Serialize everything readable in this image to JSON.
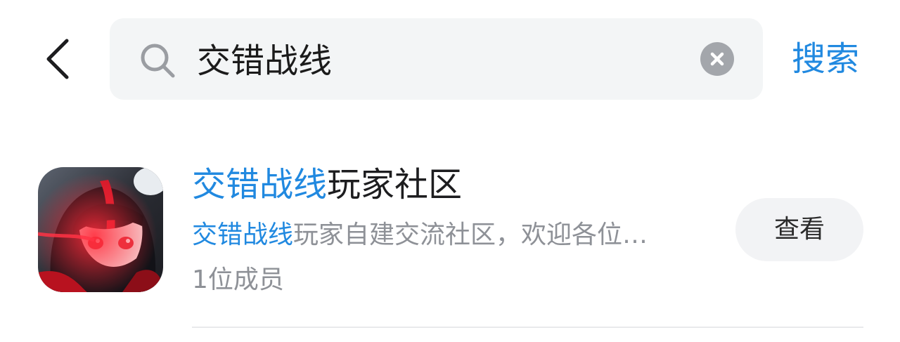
{
  "header": {
    "search_query": "交错战线",
    "search_button_label": "搜索",
    "accent_color": "#2189e0"
  },
  "results": [
    {
      "title_highlight": "交错战线",
      "title_rest": "玩家社区",
      "desc_highlight": "交错战线",
      "desc_rest": "玩家自建交流社区，欢迎各位…",
      "members": "1位成员",
      "view_label": "查看"
    }
  ],
  "icons": {
    "back": "chevron-left-icon",
    "search": "search-icon",
    "clear": "clear-icon"
  }
}
